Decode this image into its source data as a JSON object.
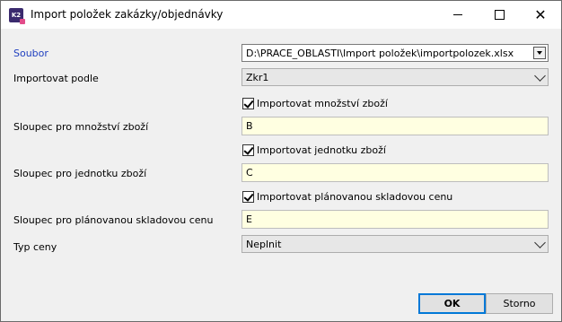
{
  "window": {
    "title": "Import položek zakázky/objednávky",
    "icon_text": "K2"
  },
  "form": {
    "soubor": {
      "label": "Soubor",
      "value": "D:\\PRACE_OBLASTI\\Import položek\\importpolozek.xlsx"
    },
    "importovat_podle": {
      "label": "Importovat podle",
      "value": "Zkr1"
    },
    "mnozstvi_check": {
      "label": "Importovat množství zboží",
      "checked": true
    },
    "mnozstvi_col": {
      "label": "Sloupec pro množství zboží",
      "value": "B"
    },
    "jednotka_check": {
      "label": "Importovat jednotku zboží",
      "checked": true
    },
    "jednotka_col": {
      "label": "Sloupec pro jednotku zboží",
      "value": "C"
    },
    "cena_check": {
      "label": "Importovat plánovanou skladovou cenu",
      "checked": true
    },
    "cena_col": {
      "label": "Sloupec pro plánovanou skladovou cenu",
      "value": "E"
    },
    "typ_ceny": {
      "label": "Typ ceny",
      "value": "Neplnit"
    }
  },
  "buttons": {
    "ok": "OK",
    "cancel": "Storno"
  },
  "colors": {
    "input_bg": "#ffffe1",
    "accent": "#0078d7",
    "label_blue": "#1f3fbf"
  }
}
